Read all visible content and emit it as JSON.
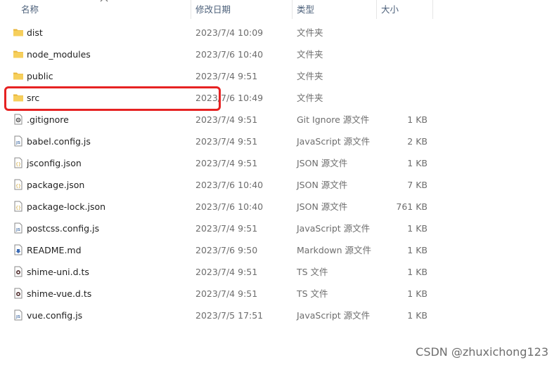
{
  "columns": {
    "name": "名称",
    "date": "修改日期",
    "type": "类型",
    "size": "大小"
  },
  "files": [
    {
      "name": "dist",
      "date": "2023/7/4 10:09",
      "type": "文件夹",
      "size": "",
      "icon": "folder-icon"
    },
    {
      "name": "node_modules",
      "date": "2023/7/6 10:40",
      "type": "文件夹",
      "size": "",
      "icon": "folder-icon"
    },
    {
      "name": "public",
      "date": "2023/7/4 9:51",
      "type": "文件夹",
      "size": "",
      "icon": "folder-icon"
    },
    {
      "name": "src",
      "date": "2023/7/6 10:49",
      "type": "文件夹",
      "size": "",
      "icon": "folder-icon"
    },
    {
      "name": ".gitignore",
      "date": "2023/7/4 9:51",
      "type": "Git Ignore 源文件",
      "size": "1 KB",
      "icon": "gear-file-icon"
    },
    {
      "name": "babel.config.js",
      "date": "2023/7/4 9:51",
      "type": "JavaScript 源文件",
      "size": "2 KB",
      "icon": "js-file-icon"
    },
    {
      "name": "jsconfig.json",
      "date": "2023/7/4 9:51",
      "type": "JSON 源文件",
      "size": "1 KB",
      "icon": "json-file-icon"
    },
    {
      "name": "package.json",
      "date": "2023/7/6 10:40",
      "type": "JSON 源文件",
      "size": "7 KB",
      "icon": "json-file-icon"
    },
    {
      "name": "package-lock.json",
      "date": "2023/7/6 10:40",
      "type": "JSON 源文件",
      "size": "761 KB",
      "icon": "json-file-icon"
    },
    {
      "name": "postcss.config.js",
      "date": "2023/7/4 9:51",
      "type": "JavaScript 源文件",
      "size": "1 KB",
      "icon": "js-file-icon"
    },
    {
      "name": "README.md",
      "date": "2023/7/6 9:50",
      "type": "Markdown 源文件",
      "size": "1 KB",
      "icon": "markdown-file-icon"
    },
    {
      "name": "shime-uni.d.ts",
      "date": "2023/7/4 9:51",
      "type": "TS 文件",
      "size": "1 KB",
      "icon": "ts-file-icon"
    },
    {
      "name": "shime-vue.d.ts",
      "date": "2023/7/4 9:51",
      "type": "TS 文件",
      "size": "1 KB",
      "icon": "ts-file-icon"
    },
    {
      "name": "vue.config.js",
      "date": "2023/7/5 17:51",
      "type": "JavaScript 源文件",
      "size": "1 KB",
      "icon": "js-file-icon"
    }
  ],
  "highlighted_item": "src",
  "watermark": "CSDN @zhuxichong123",
  "colors": {
    "highlight": "#e62222",
    "folder": "#f3c44d"
  }
}
